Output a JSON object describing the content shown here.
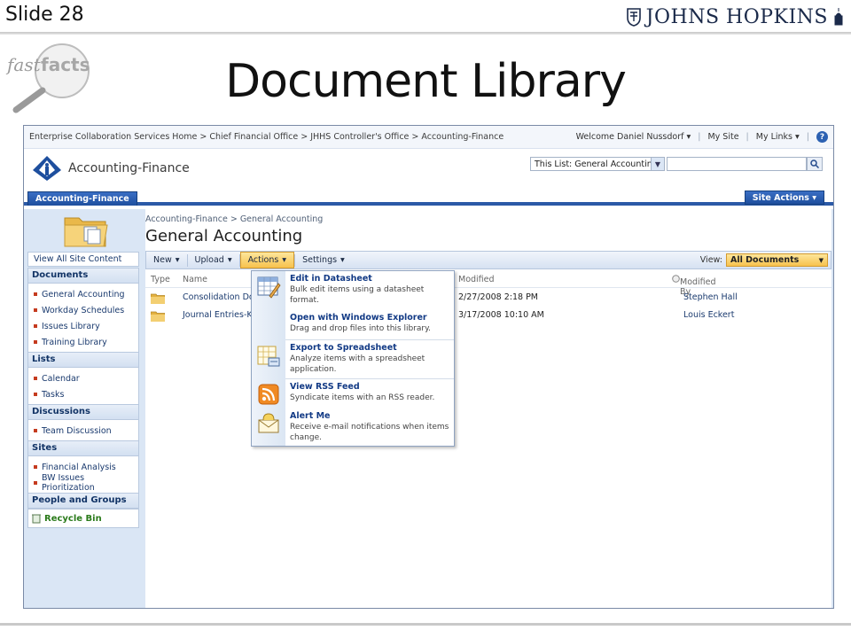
{
  "slide": {
    "number_label": "Slide 28",
    "title": "Document Library",
    "logo_text": "JOHNS HOPKINS",
    "badge_text_a": "fast",
    "badge_text_b": "facts"
  },
  "colors": {
    "accent": "#2b5aa7",
    "highlight": "#f7c24e",
    "link": "#1a3a6e",
    "bullet": "#c53b1f"
  },
  "global_bar": {
    "breadcrumb": "Enterprise Collaboration Services Home > Chief Financial Office > JHHS Controller's Office > Accounting-Finance",
    "welcome": "Welcome Daniel Nussdorf",
    "my_site": "My Site",
    "my_links": "My Links",
    "help_glyph": "?"
  },
  "header": {
    "site_title": "Accounting-Finance",
    "search_scope": "This List: General Accounting",
    "search_value": ""
  },
  "tabs": {
    "active": "Accounting-Finance",
    "site_actions": "Site Actions"
  },
  "page": {
    "breadcrumb": "Accounting-Finance > General Accounting",
    "title": "General Accounting"
  },
  "left_nav": {
    "view_all": "View All Site Content",
    "sections": [
      {
        "heading": "Documents",
        "links": [
          "General Accounting",
          "Workday Schedules",
          "Issues Library",
          "Training Library"
        ]
      },
      {
        "heading": "Lists",
        "links": [
          "Calendar",
          "Tasks"
        ]
      },
      {
        "heading": "Discussions",
        "links": [
          "Team Discussion"
        ]
      },
      {
        "heading": "Sites",
        "links": [
          "Financial Analysis",
          "BW Issues Prioritization"
        ]
      }
    ],
    "people_groups": "People and Groups",
    "recycle_bin": "Recycle Bin"
  },
  "toolbar": {
    "new": "New",
    "upload": "Upload",
    "actions": "Actions",
    "settings": "Settings",
    "view_label": "View:",
    "view_value": "All Documents"
  },
  "list": {
    "columns": {
      "type": "Type",
      "name": "Name",
      "modified": "Modified",
      "modified_by": "Modified By"
    },
    "rows": [
      {
        "name": "Consolidation Doc",
        "modified": "2/27/2008 2:18 PM",
        "modified_by": "Stephen Hall"
      },
      {
        "name": "Journal Entries-KE",
        "modified": "3/17/2008 10:10 AM",
        "modified_by": "Louis Eckert"
      }
    ]
  },
  "actions_menu": [
    {
      "icon": "datasheet-icon",
      "title": "Edit in Datasheet",
      "desc": "Bulk edit items using a datasheet format."
    },
    {
      "icon": "explorer-icon",
      "title": "Open with Windows Explorer",
      "desc": "Drag and drop files into this library."
    },
    {
      "icon": "spreadsheet-icon",
      "title": "Export to Spreadsheet",
      "desc": "Analyze items with a spreadsheet application."
    },
    {
      "icon": "rss-icon",
      "title": "View RSS Feed",
      "desc": "Syndicate items with an RSS reader."
    },
    {
      "icon": "alert-icon",
      "title": "Alert Me",
      "desc": "Receive e-mail notifications when items change."
    }
  ]
}
